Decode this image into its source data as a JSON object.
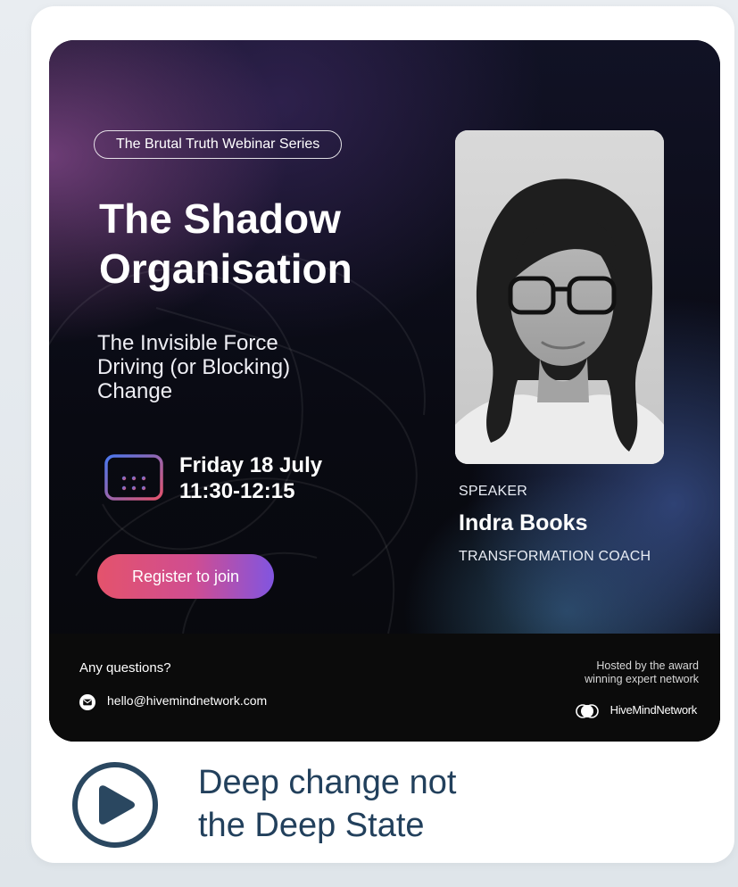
{
  "banner": {
    "series_label": "The Brutal Truth Webinar Series",
    "title_line1": "The Shadow",
    "title_line2": "Organisation",
    "subtitle_line1": "The Invisible Force",
    "subtitle_line2": "Driving (or Blocking)",
    "subtitle_line3": "Change",
    "date": "Friday 18 July",
    "time": "11:30-12:15",
    "register_label": "Register to join",
    "calendar_icon": "calendar-icon",
    "speaker": {
      "label": "SPEAKER",
      "name": "Indra Books",
      "role": "TRANSFORMATION COACH"
    },
    "colors": {
      "accent_start": "#e4536c",
      "accent_end": "#8155e0",
      "calendar_blue": "#4a78f0",
      "calendar_pink": "#e4536c"
    }
  },
  "footer": {
    "questions": "Any questions?",
    "email": "hello@hivemindnetwork.com",
    "hosted_line1": "Hosted by the award",
    "hosted_line2": "winning expert network",
    "brand": "HiveMindNetwork"
  },
  "caption": {
    "line1": "Deep change not",
    "line2": "the Deep State",
    "color": "#22405c"
  }
}
